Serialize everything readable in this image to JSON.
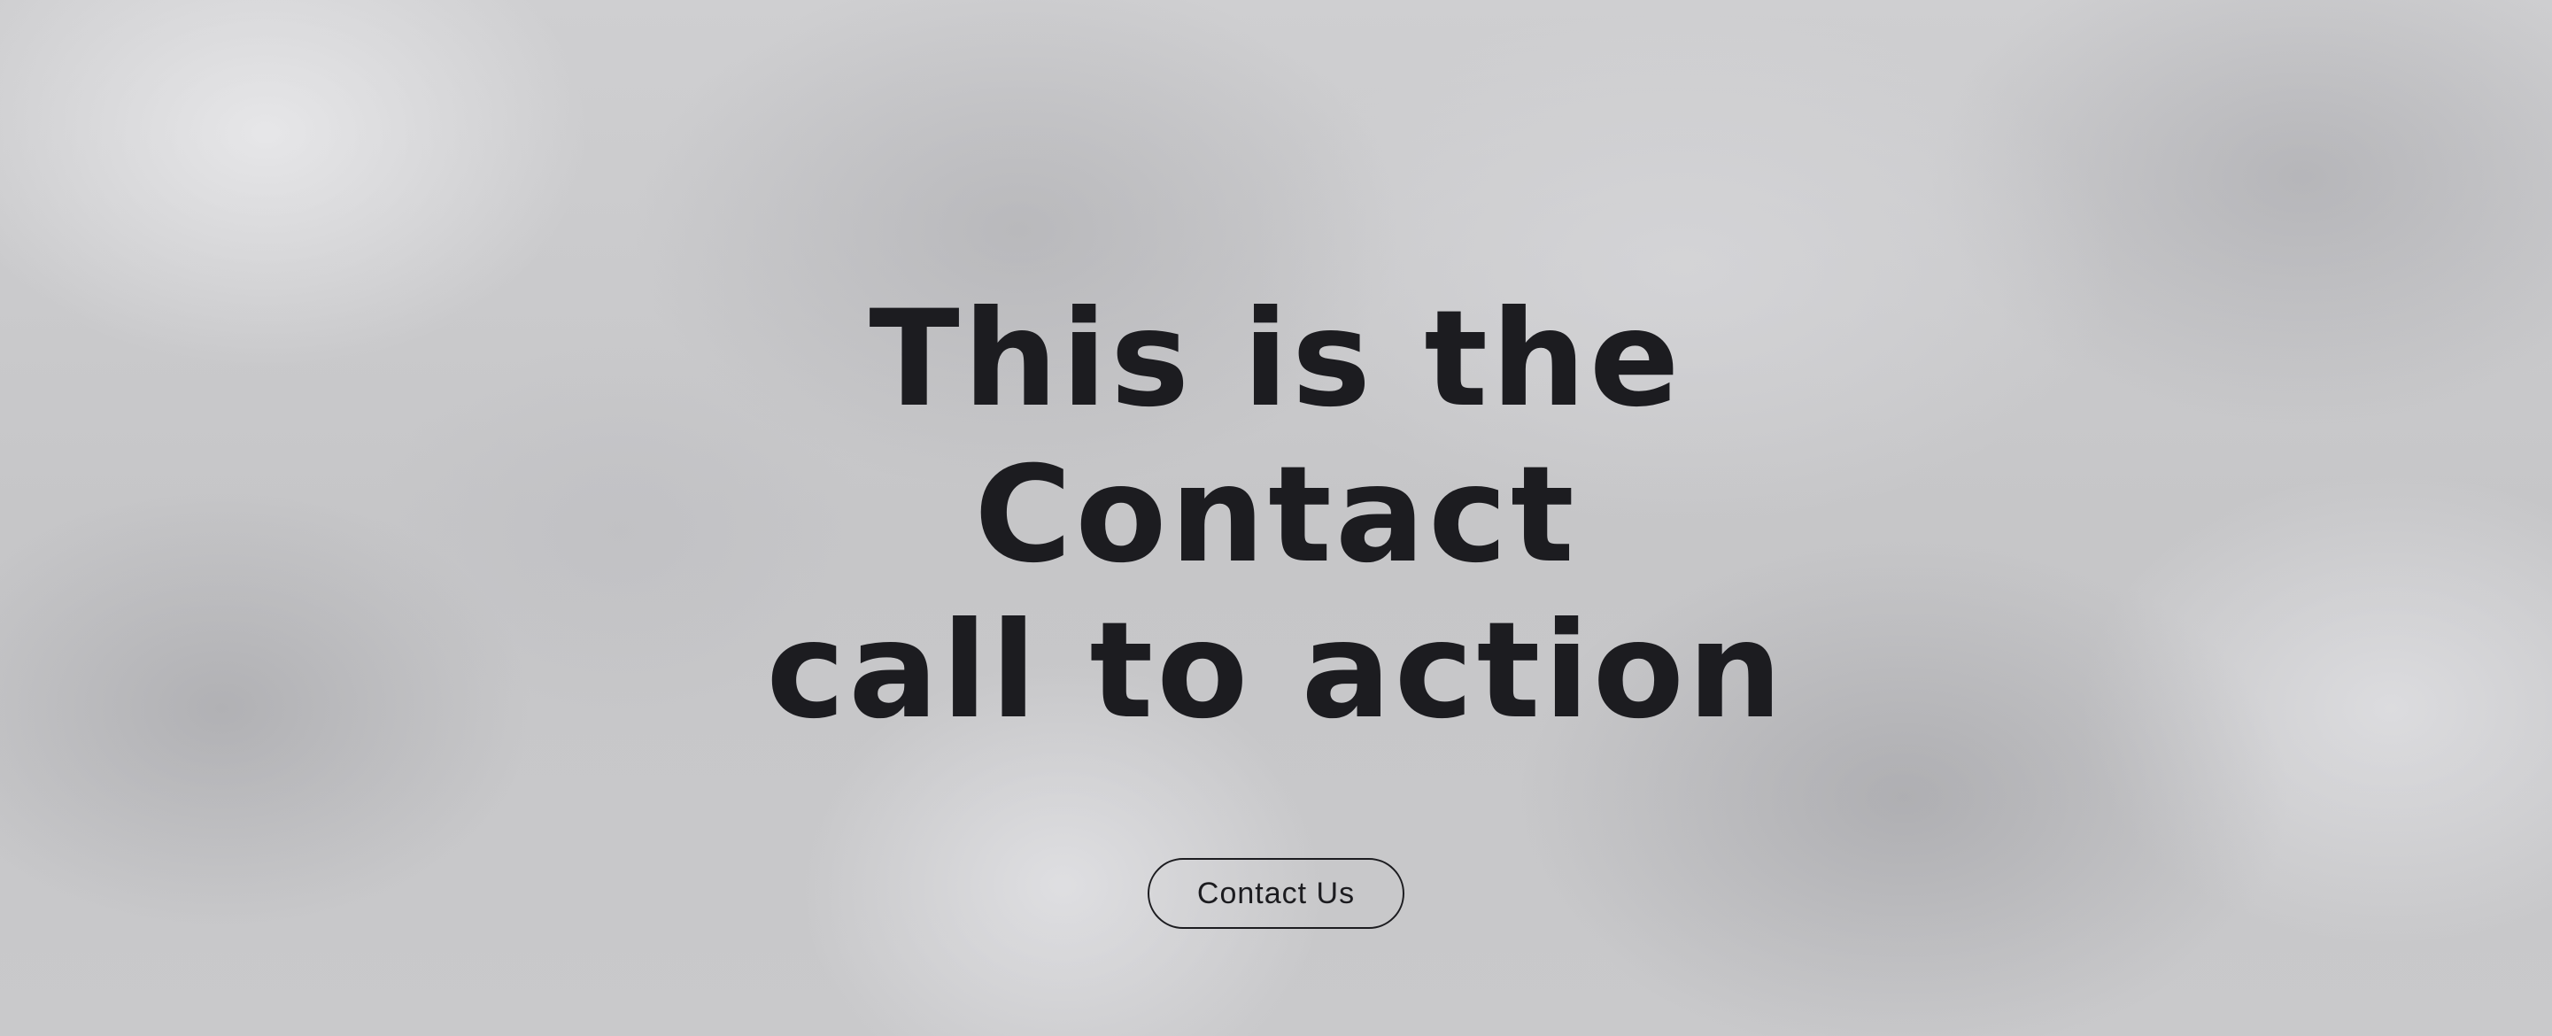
{
  "hero": {
    "headline_line1": "This is the Contact",
    "headline_line2": "call to action",
    "button_label": "Contact Us"
  }
}
